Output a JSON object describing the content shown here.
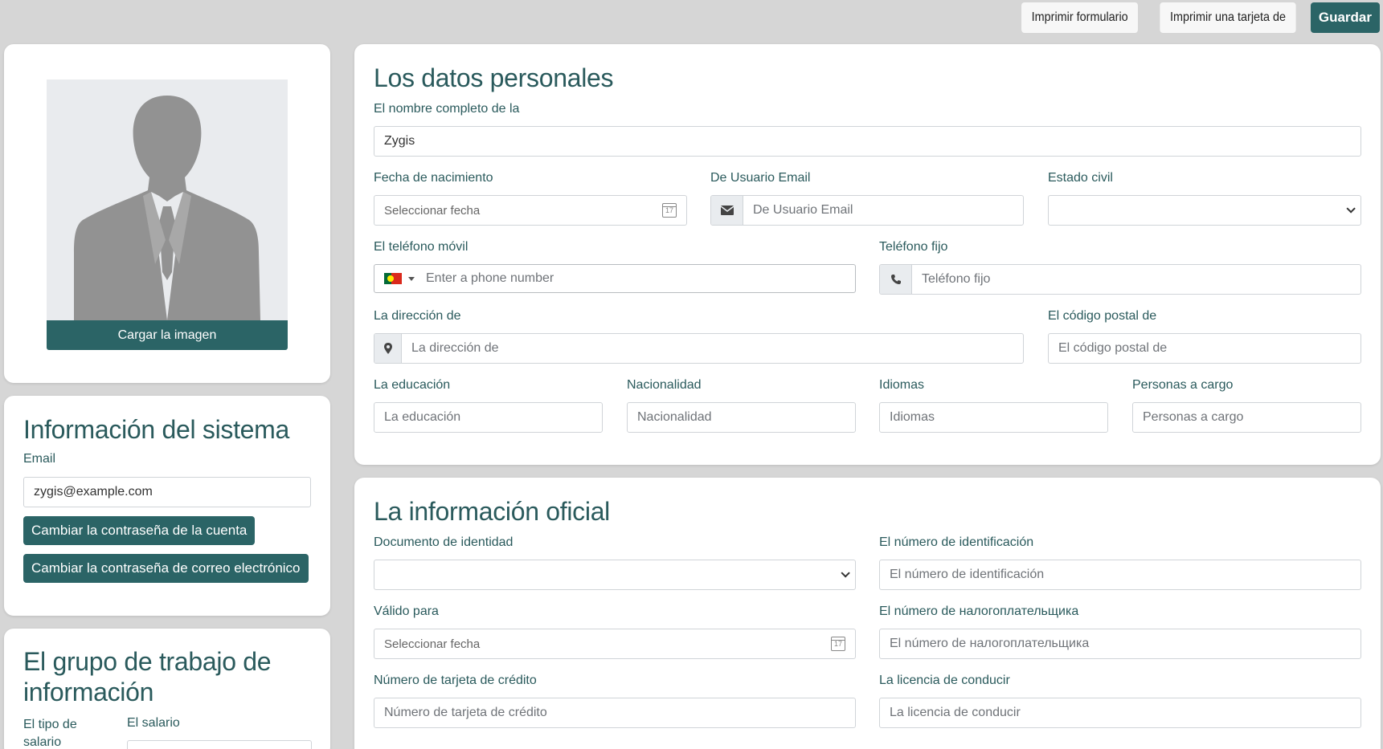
{
  "toolbar": {
    "print_form": "Imprimir formulario",
    "print_card": "Imprimir una tarjeta de",
    "save": "Guardar"
  },
  "photo": {
    "upload_label": "Cargar la imagen"
  },
  "system": {
    "title": "Información del sistema",
    "email_label": "Email",
    "email_value": "zygis@example.com",
    "change_account_password": "Cambiar la contraseña de la cuenta",
    "change_email_password": "Cambiar la contraseña de correo electrónico"
  },
  "work_group": {
    "title": "El grupo de trabajo de información",
    "salary_type_label": "El tipo de salario",
    "salary_label": "El salario"
  },
  "personal": {
    "title": "Los datos personales",
    "full_name_label": "El nombre completo de la",
    "full_name_value": "Zygis",
    "birth_date_label": "Fecha de nacimiento",
    "birth_date_placeholder": "Seleccionar fecha",
    "user_email_label": "De Usuario Email",
    "user_email_placeholder": "De Usuario Email",
    "marital_status_label": "Estado civil",
    "marital_status_value": "",
    "mobile_label": "El teléfono móvil",
    "mobile_placeholder": "Enter a phone number",
    "landline_label": "Teléfono fijo",
    "landline_placeholder": "Teléfono fijo",
    "address_label": "La dirección de",
    "address_placeholder": "La dirección de",
    "postal_label": "El código postal de",
    "postal_placeholder": "El código postal de",
    "education_label": "La educación",
    "education_placeholder": "La educación",
    "nationality_label": "Nacionalidad",
    "nationality_placeholder": "Nacionalidad",
    "languages_label": "Idiomas",
    "languages_placeholder": "Idiomas",
    "dependents_label": "Personas a cargo",
    "dependents_placeholder": "Personas a cargo"
  },
  "official": {
    "title": "La información oficial",
    "id_doc_label": "Documento de identidad",
    "id_doc_value": "",
    "id_number_label": "El número de identificación",
    "id_number_placeholder": "El número de identificación",
    "valid_label": "Válido para",
    "valid_placeholder": "Seleccionar fecha",
    "tax_label": "El número de налогоплательщика",
    "tax_placeholder": "El número de налогоплательщика",
    "card_label": "Número de tarjeta de crédito",
    "card_placeholder": "Número de tarjeta de crédito",
    "license_label": "La licencia de conducir",
    "license_placeholder": "La licencia de conducir"
  },
  "colors": {
    "primary": "#2b6466",
    "heading": "#2a5a5c",
    "background": "#d6d6d6"
  },
  "icons": {
    "email": "envelope-icon",
    "phone": "phone-icon",
    "address": "map-marker-icon",
    "calendar": "calendar-icon",
    "select": "chevron-down-icon"
  }
}
